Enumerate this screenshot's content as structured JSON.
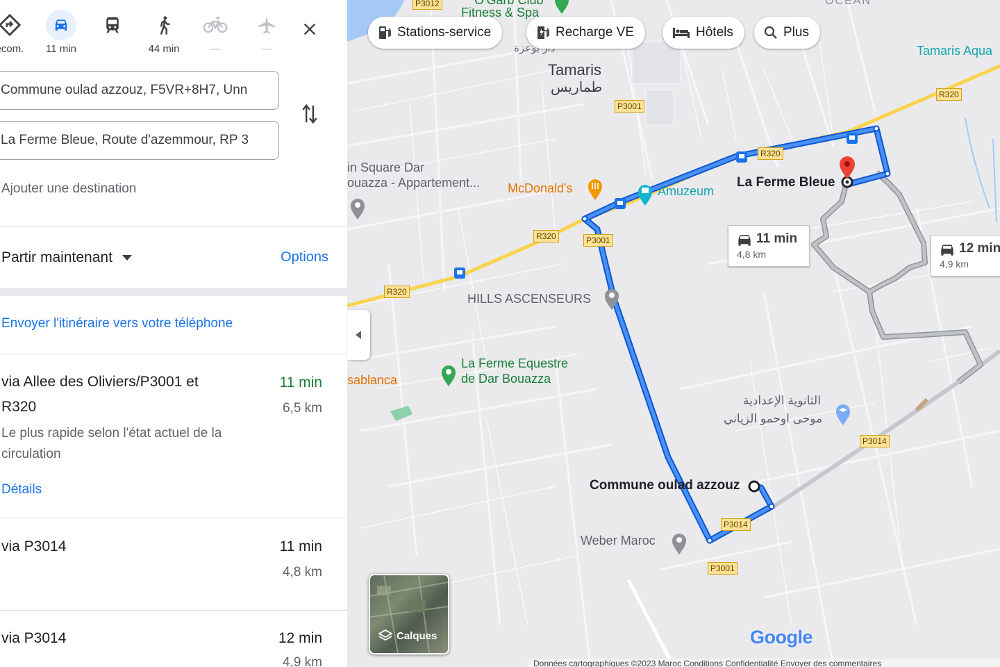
{
  "modes": [
    {
      "name": "recommended",
      "label": "ecom."
    },
    {
      "name": "car",
      "label": "11 min"
    },
    {
      "name": "transit",
      "label": ""
    },
    {
      "name": "walk",
      "label": "44 min"
    },
    {
      "name": "bike",
      "label": "—"
    },
    {
      "name": "flight",
      "label": "—"
    }
  ],
  "origin": "Commune oulad azzouz, F5VR+8H7, Unn",
  "destination": "La Ferme Bleue, Route d'azemmour, RP 3",
  "add_destination": "Ajouter une destination",
  "depart": "Partir maintenant",
  "options": "Options",
  "send_to_phone": "Envoyer l'itinéraire vers votre téléphone",
  "routes": [
    {
      "via_line1": "via Allee des Oliviers/P3001 et",
      "via_line2": "R320",
      "time": "11 min",
      "dist": "6,5 km",
      "desc_line1": "Le plus rapide selon l'état actuel de la",
      "desc_line2": "circulation",
      "details": "Détails"
    },
    {
      "via_line1": "via P3014",
      "time": "11 min",
      "dist": "4,8 km"
    },
    {
      "via_line1": "via P3014",
      "time": "12 min",
      "dist": "4,9 km"
    }
  ],
  "chips": {
    "stations": "Stations-service",
    "recharge": "Recharge VE",
    "hotels": "Hôtels",
    "plus": "Plus"
  },
  "map": {
    "labels": {
      "tamaris": "Tamaris",
      "tamaris_ar": "طماريس",
      "dar_bouazza_ar": "دار بوعزة",
      "tamaris_aqua": "Tamaris Aqua",
      "ocean": "OCEAN",
      "fitness": "Fitness & Spa",
      "club": "O'Garb Club",
      "square1": "in Square Dar",
      "square2": "ouazza - Appartement...",
      "mcdonalds": "McDonald's",
      "amuzeum": "Amuzeum",
      "ferme_bleue": "La Ferme Bleue",
      "hills": "HILLS ASCENSEURS",
      "equestre1": "La Ferme Equestre",
      "equestre2": "de Dar Bouazza",
      "casablanca": "sablanca",
      "school1": "الثانوية الإعدادية",
      "school2": "موحى اوحمو الزياني",
      "commune": "Commune oulad azzouz",
      "weber": "Weber Maroc",
      "calques": "Calques",
      "google": "Google",
      "footer": "Données cartographiques ©2023   Maroc   Conditions   Confidentialité   Envoyer des commentaires"
    },
    "shields": [
      "P3012",
      "P3001",
      "R320",
      "R320",
      "R320",
      "R320",
      "P3001",
      "P3014",
      "P3014",
      "P3001"
    ],
    "route_boxes": [
      {
        "time": "11 min",
        "dist": "4,8 km"
      },
      {
        "time": "12 min",
        "dist": "4,9 km"
      }
    ],
    "colors": {
      "primary_route": "#1a73e8",
      "alt_route": "#a0a4a8",
      "highway": "#fbd34d",
      "accent_blue": "#1a73e8",
      "green": "#188038"
    }
  }
}
